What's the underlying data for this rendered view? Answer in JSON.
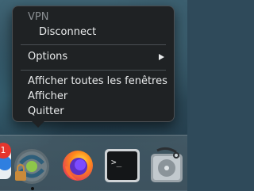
{
  "menu": {
    "header": "VPN",
    "disconnect": "Disconnect",
    "options": "Options",
    "show_all_windows": "Afficher toutes les fenêtres",
    "show": "Afficher",
    "quit": "Quitter"
  },
  "dock": {
    "badge_count": "1",
    "icons": [
      "partial-app-icon",
      "vpn-client-icon",
      "firefox-icon",
      "terminal-icon",
      "disk-utility-icon"
    ],
    "terminal_prompt": ">_"
  }
}
